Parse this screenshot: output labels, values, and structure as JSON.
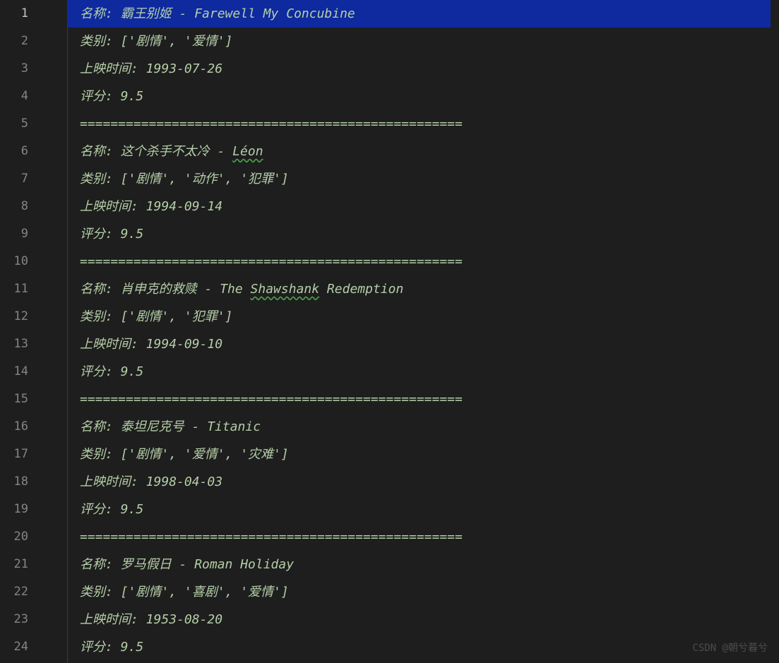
{
  "watermark": "CSDN @朝兮暮兮",
  "separator": "==================================================",
  "lines": [
    {
      "n": 1,
      "type": "name",
      "label": "名称:",
      "value": " 霸王别姬 - Farewell My Concubine",
      "highlighted": true
    },
    {
      "n": 2,
      "type": "category",
      "label": "类别:",
      "value": " ['剧情', '爱情']"
    },
    {
      "n": 3,
      "type": "date",
      "label": "上映时间:",
      "value": " 1993-07-26"
    },
    {
      "n": 4,
      "type": "rating",
      "label": "评分:",
      "value": " 9.5"
    },
    {
      "n": 5,
      "type": "sep"
    },
    {
      "n": 6,
      "type": "name",
      "label": "名称:",
      "value_pre": " 这个杀手不太冷 - ",
      "value_u": "Léon"
    },
    {
      "n": 7,
      "type": "category",
      "label": "类别:",
      "value": " ['剧情', '动作', '犯罪']"
    },
    {
      "n": 8,
      "type": "date",
      "label": "上映时间:",
      "value": " 1994-09-14"
    },
    {
      "n": 9,
      "type": "rating",
      "label": "评分:",
      "value": " 9.5"
    },
    {
      "n": 10,
      "type": "sep"
    },
    {
      "n": 11,
      "type": "name",
      "label": "名称:",
      "value_pre": " 肖申克的救赎 - The ",
      "value_u": "Shawshank",
      "value_post": " Redemption"
    },
    {
      "n": 12,
      "type": "category",
      "label": "类别:",
      "value": " ['剧情', '犯罪']"
    },
    {
      "n": 13,
      "type": "date",
      "label": "上映时间:",
      "value": " 1994-09-10"
    },
    {
      "n": 14,
      "type": "rating",
      "label": "评分:",
      "value": " 9.5"
    },
    {
      "n": 15,
      "type": "sep"
    },
    {
      "n": 16,
      "type": "name",
      "label": "名称:",
      "value": " 泰坦尼克号 - Titanic"
    },
    {
      "n": 17,
      "type": "category",
      "label": "类别:",
      "value": " ['剧情', '爱情', '灾难']"
    },
    {
      "n": 18,
      "type": "date",
      "label": "上映时间:",
      "value": " 1998-04-03"
    },
    {
      "n": 19,
      "type": "rating",
      "label": "评分:",
      "value": " 9.5"
    },
    {
      "n": 20,
      "type": "sep"
    },
    {
      "n": 21,
      "type": "name",
      "label": "名称:",
      "value": " 罗马假日 - Roman Holiday"
    },
    {
      "n": 22,
      "type": "category",
      "label": "类别:",
      "value": " ['剧情', '喜剧', '爱情']"
    },
    {
      "n": 23,
      "type": "date",
      "label": "上映时间:",
      "value": " 1953-08-20"
    },
    {
      "n": 24,
      "type": "rating",
      "label": "评分:",
      "value": " 9.5"
    }
  ]
}
